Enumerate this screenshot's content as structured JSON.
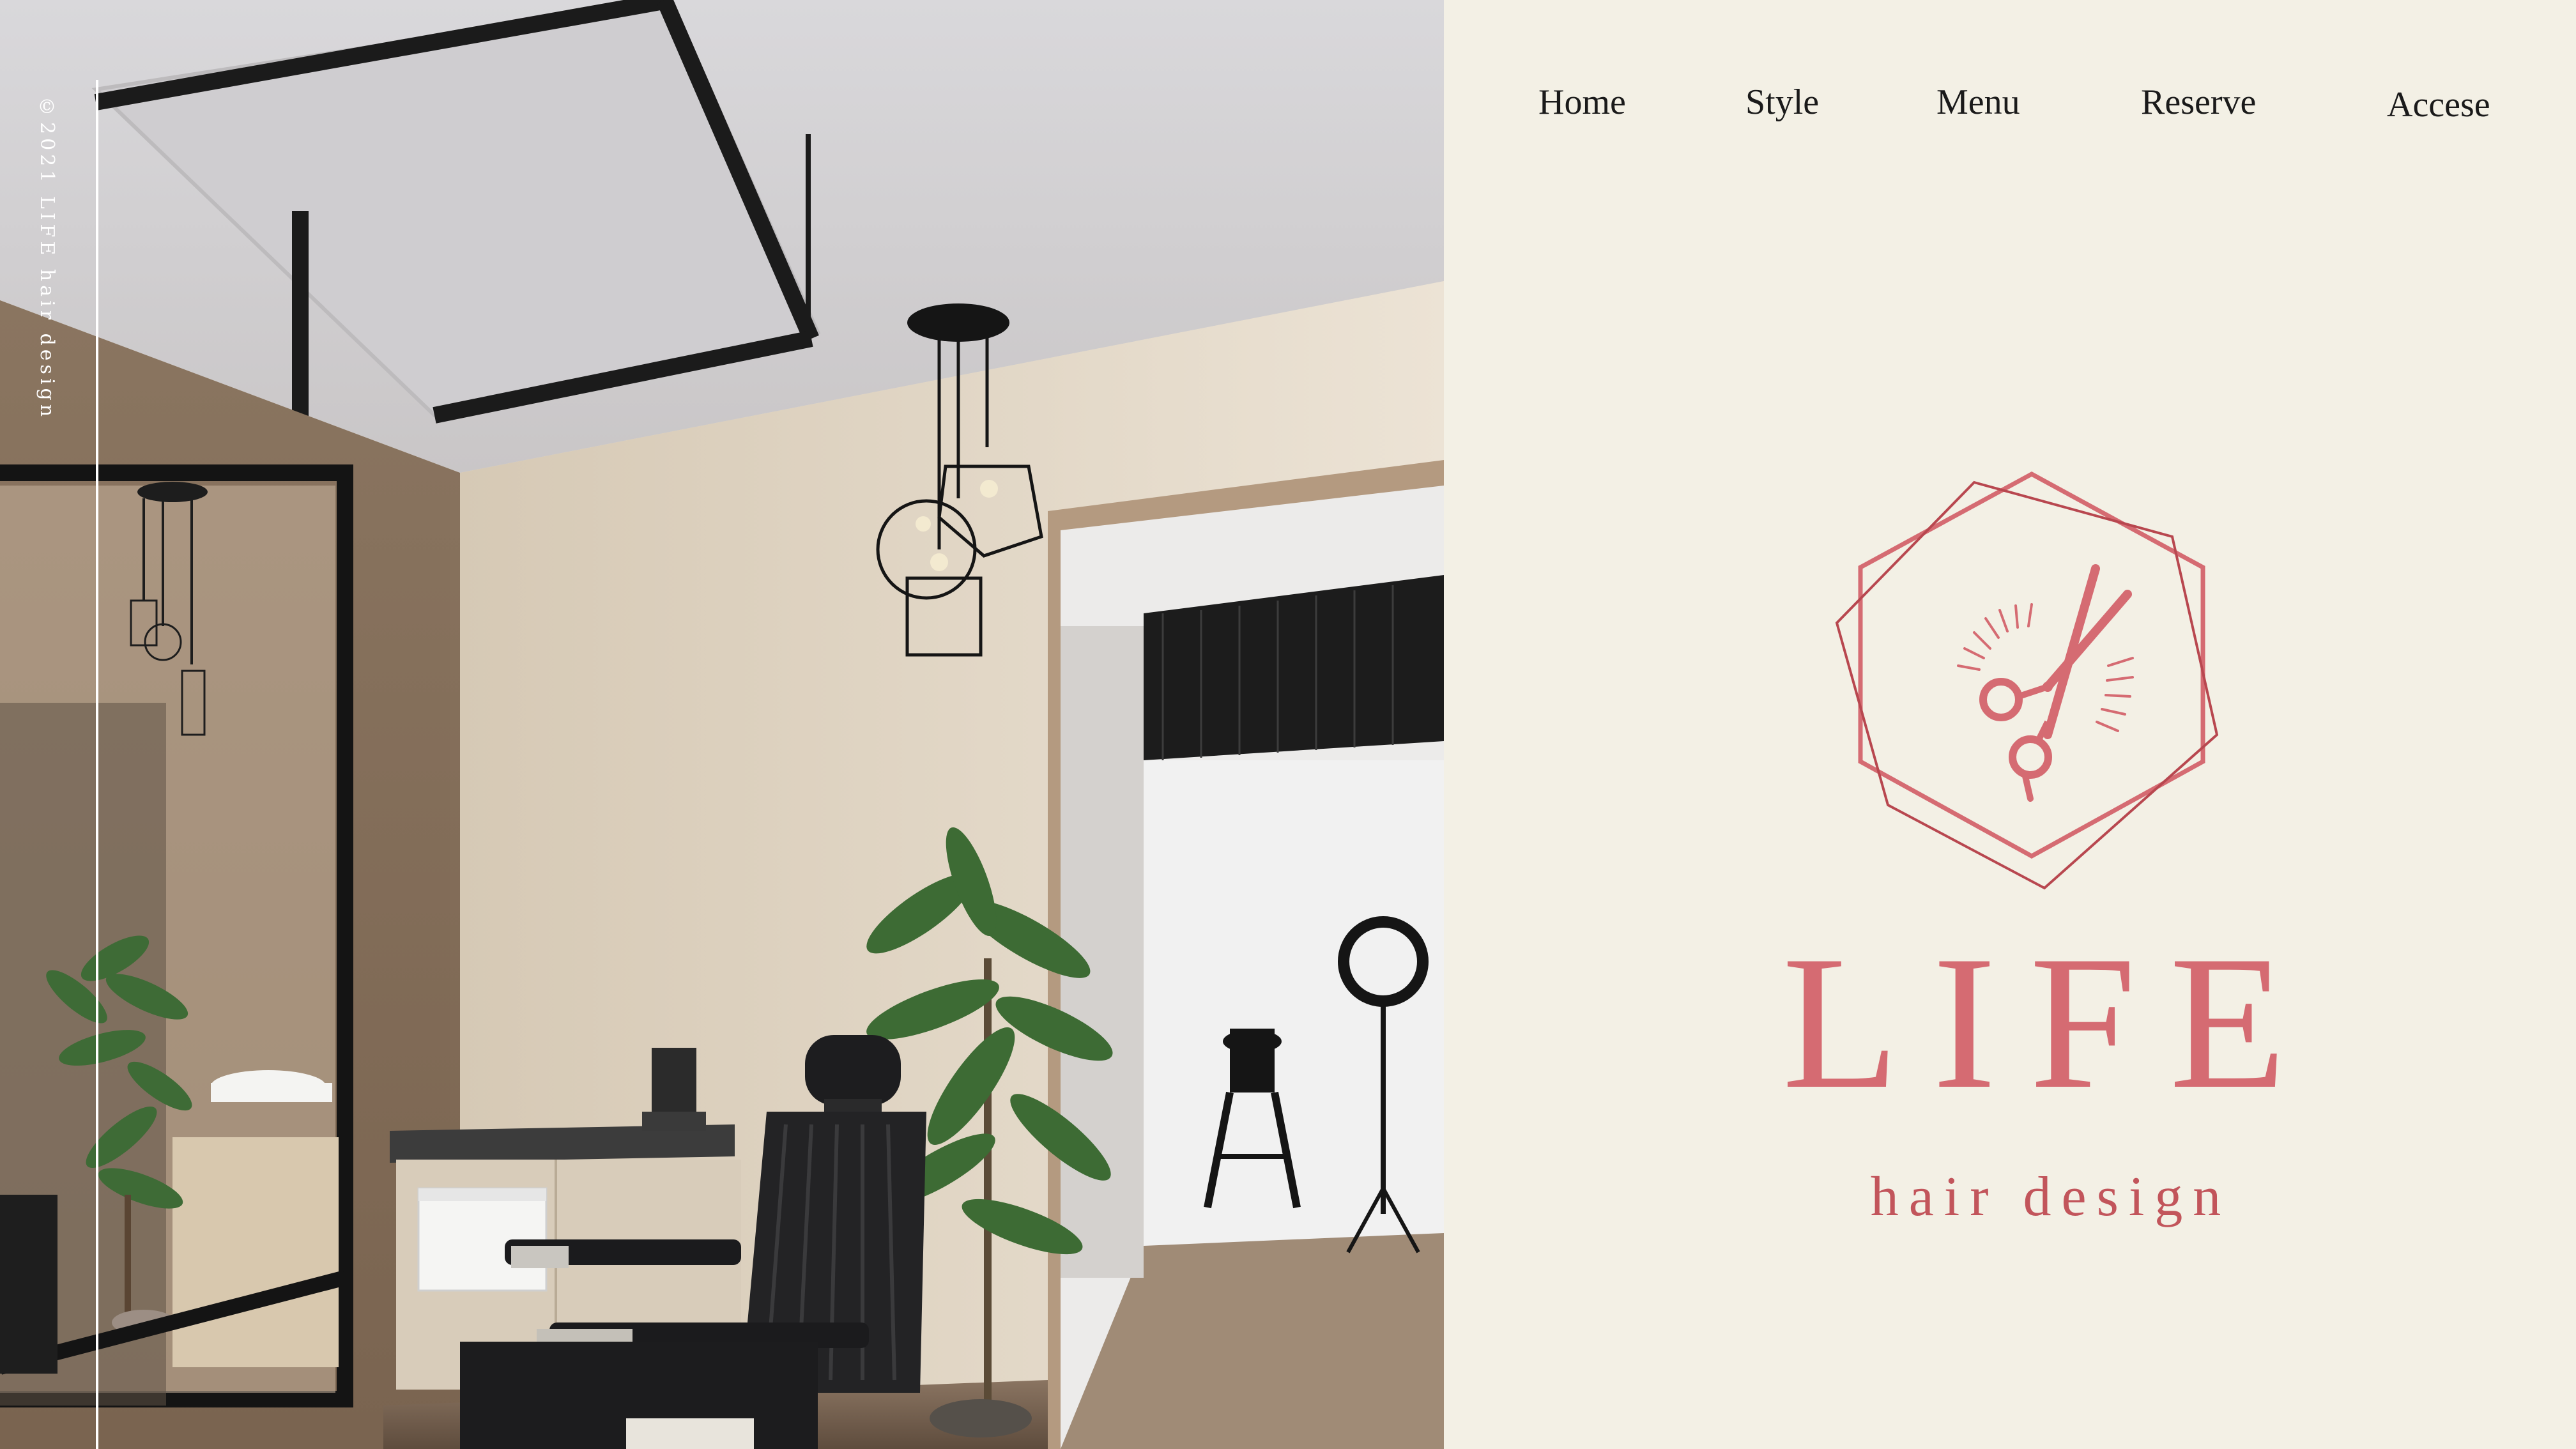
{
  "site": {
    "copyright": "©2021 LIFE hair design"
  },
  "nav": {
    "items": [
      {
        "label": "Home"
      },
      {
        "label": "Style"
      },
      {
        "label": "Menu"
      },
      {
        "label": "Reserve"
      },
      {
        "label": "Accese"
      }
    ]
  },
  "logo": {
    "title": "LIFE",
    "subtitle": "hair design",
    "emblem_icon": "scissors-hexagon-icon",
    "color": "#d56b72"
  },
  "hero": {
    "image": "salon-interior-photo"
  },
  "colors": {
    "panel_background": "#f3f0e5",
    "accent": "#d56b72",
    "nav_text": "#1a1a1a"
  }
}
